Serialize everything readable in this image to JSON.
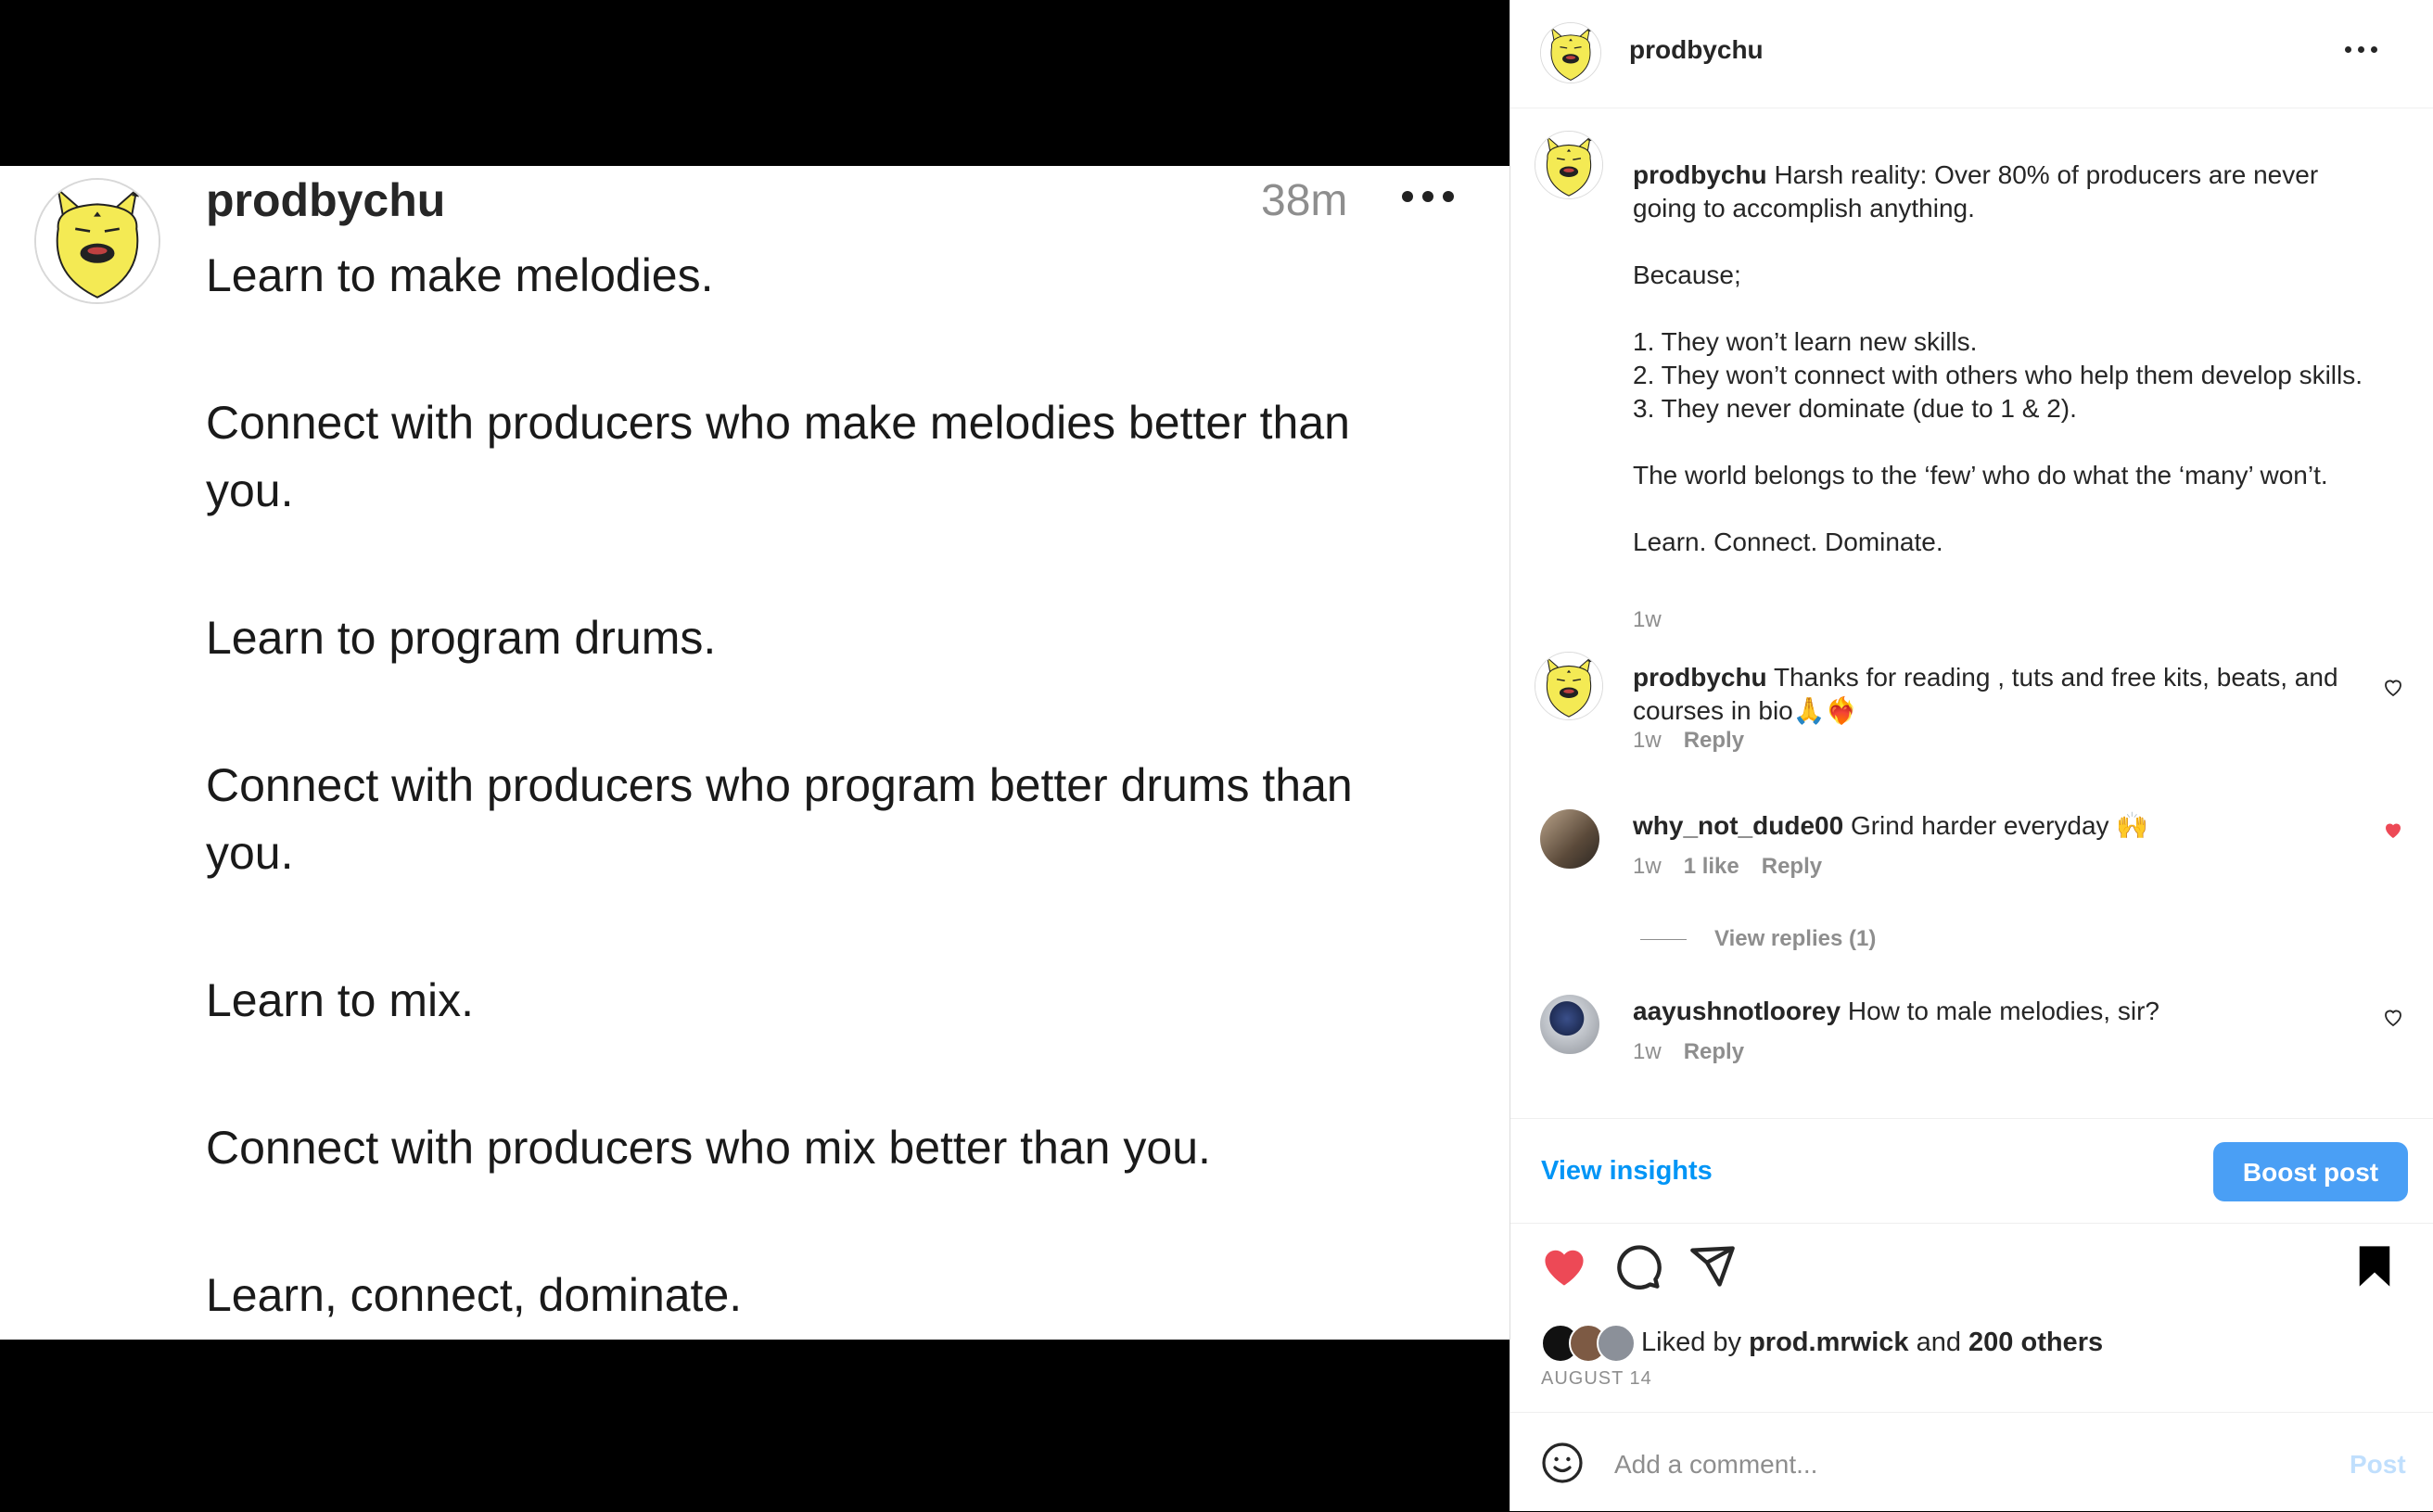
{
  "tweet": {
    "username": "prodbychu",
    "time": "38m",
    "paragraphs": [
      "Learn to make melodies.",
      "Connect with producers who make melodies better than you.",
      "Learn to program drums.",
      "Connect with producers who program better drums than you.",
      "Learn to mix.",
      "Connect with producers who mix better than you.",
      "Learn, connect, dominate."
    ]
  },
  "header": {
    "username": "prodbychu"
  },
  "caption": {
    "username": "prodbychu",
    "line1": "Harsh reality: Over 80% of producers are never going to accomplish anything.",
    "line2": "Because;",
    "line3a": "1. They won’t learn new skills.",
    "line3b": "2. They won’t connect with others who help them develop skills.",
    "line3c": "3. They never dominate (due to 1 & 2).",
    "line4": "The world belongs to the ‘few’ who do what the ‘many’ won’t.",
    "line5": "Learn. Connect. Dominate.",
    "time": "1w"
  },
  "comments": [
    {
      "username": "prodbychu",
      "text": "Thanks for reading , tuts and free kits, beats, and courses in bio🙏❤️‍🔥",
      "time": "1w",
      "reply": "Reply",
      "liked": false
    },
    {
      "username": "why_not_dude00",
      "text": "Grind harder everyday 🙌",
      "time": "1w",
      "likes": "1 like",
      "reply": "Reply",
      "liked": true
    },
    {
      "username": "aayushnotloorey",
      "text": "How to male melodies, sir?",
      "time": "1w",
      "reply": "Reply",
      "liked": false
    }
  ],
  "view_replies": "View replies (1)",
  "insights": {
    "view_insights": "View insights",
    "boost_post": "Boost post"
  },
  "likes": {
    "prefix": "Liked by",
    "user": "prod.mrwick",
    "and": "and",
    "others": "200 others"
  },
  "date": "AUGUST 14",
  "add_comment": {
    "placeholder": "Add a comment...",
    "post": "Post"
  },
  "colors": {
    "link": "#0095f6",
    "boost": "#4a9ff5",
    "like_red": "#ed4956",
    "avatar_yellow": "#f4ea54"
  }
}
